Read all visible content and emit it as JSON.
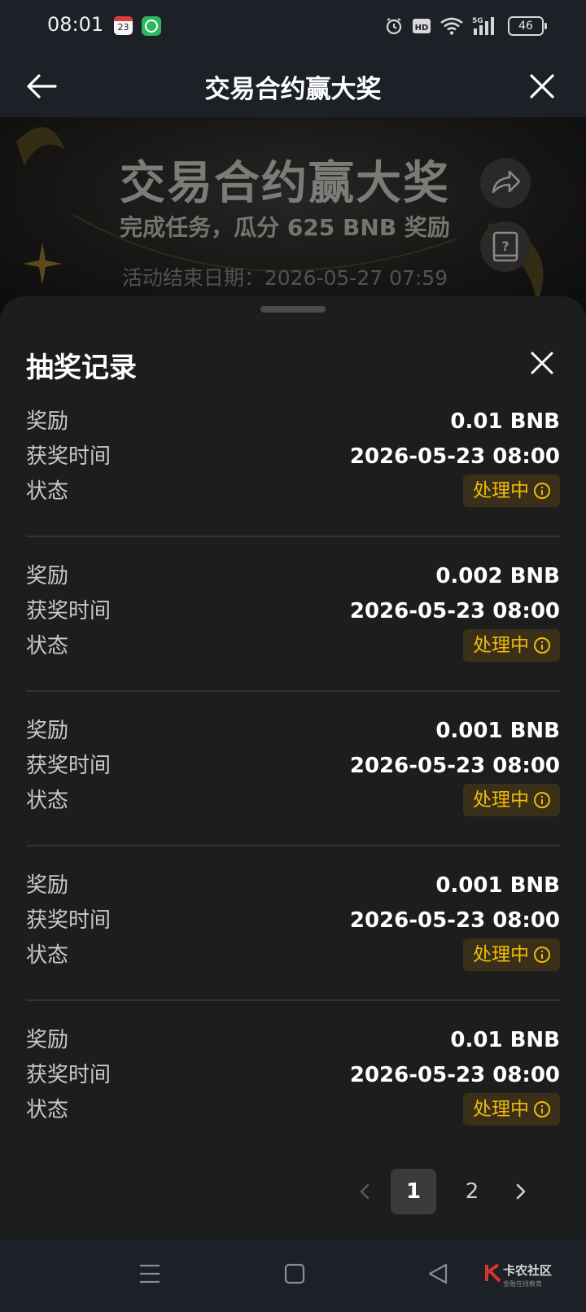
{
  "status_bar": {
    "time": "08:01",
    "calendar_day": "23",
    "battery": "46",
    "network": "5G",
    "hd_badge": "HD"
  },
  "header": {
    "title": "交易合约赢大奖"
  },
  "hero": {
    "title": "交易合约赢大奖",
    "subtitle": "完成任务，瓜分 625 BNB 奖励",
    "end_date": "活动结束日期：2026-05-27 07:59"
  },
  "sheet": {
    "title": "抽奖记录",
    "labels": {
      "reward": "奖励",
      "time": "获奖时间",
      "status": "状态"
    },
    "records": [
      {
        "reward": "0.01 BNB",
        "time": "2026-05-23 08:00",
        "status": "处理中"
      },
      {
        "reward": "0.002 BNB",
        "time": "2026-05-23 08:00",
        "status": "处理中"
      },
      {
        "reward": "0.001 BNB",
        "time": "2026-05-23 08:00",
        "status": "处理中"
      },
      {
        "reward": "0.001 BNB",
        "time": "2026-05-23 08:00",
        "status": "处理中"
      },
      {
        "reward": "0.01 BNB",
        "time": "2026-05-23 08:00",
        "status": "处理中"
      }
    ]
  },
  "pagination": {
    "current": "1",
    "next_page": "2"
  },
  "watermark": {
    "text": "卡农社区",
    "sub": "金融在线教育"
  },
  "colors": {
    "accent": "#f0b90b",
    "sheet_bg": "#1d1d1e",
    "badge_bg": "#3a301a"
  }
}
